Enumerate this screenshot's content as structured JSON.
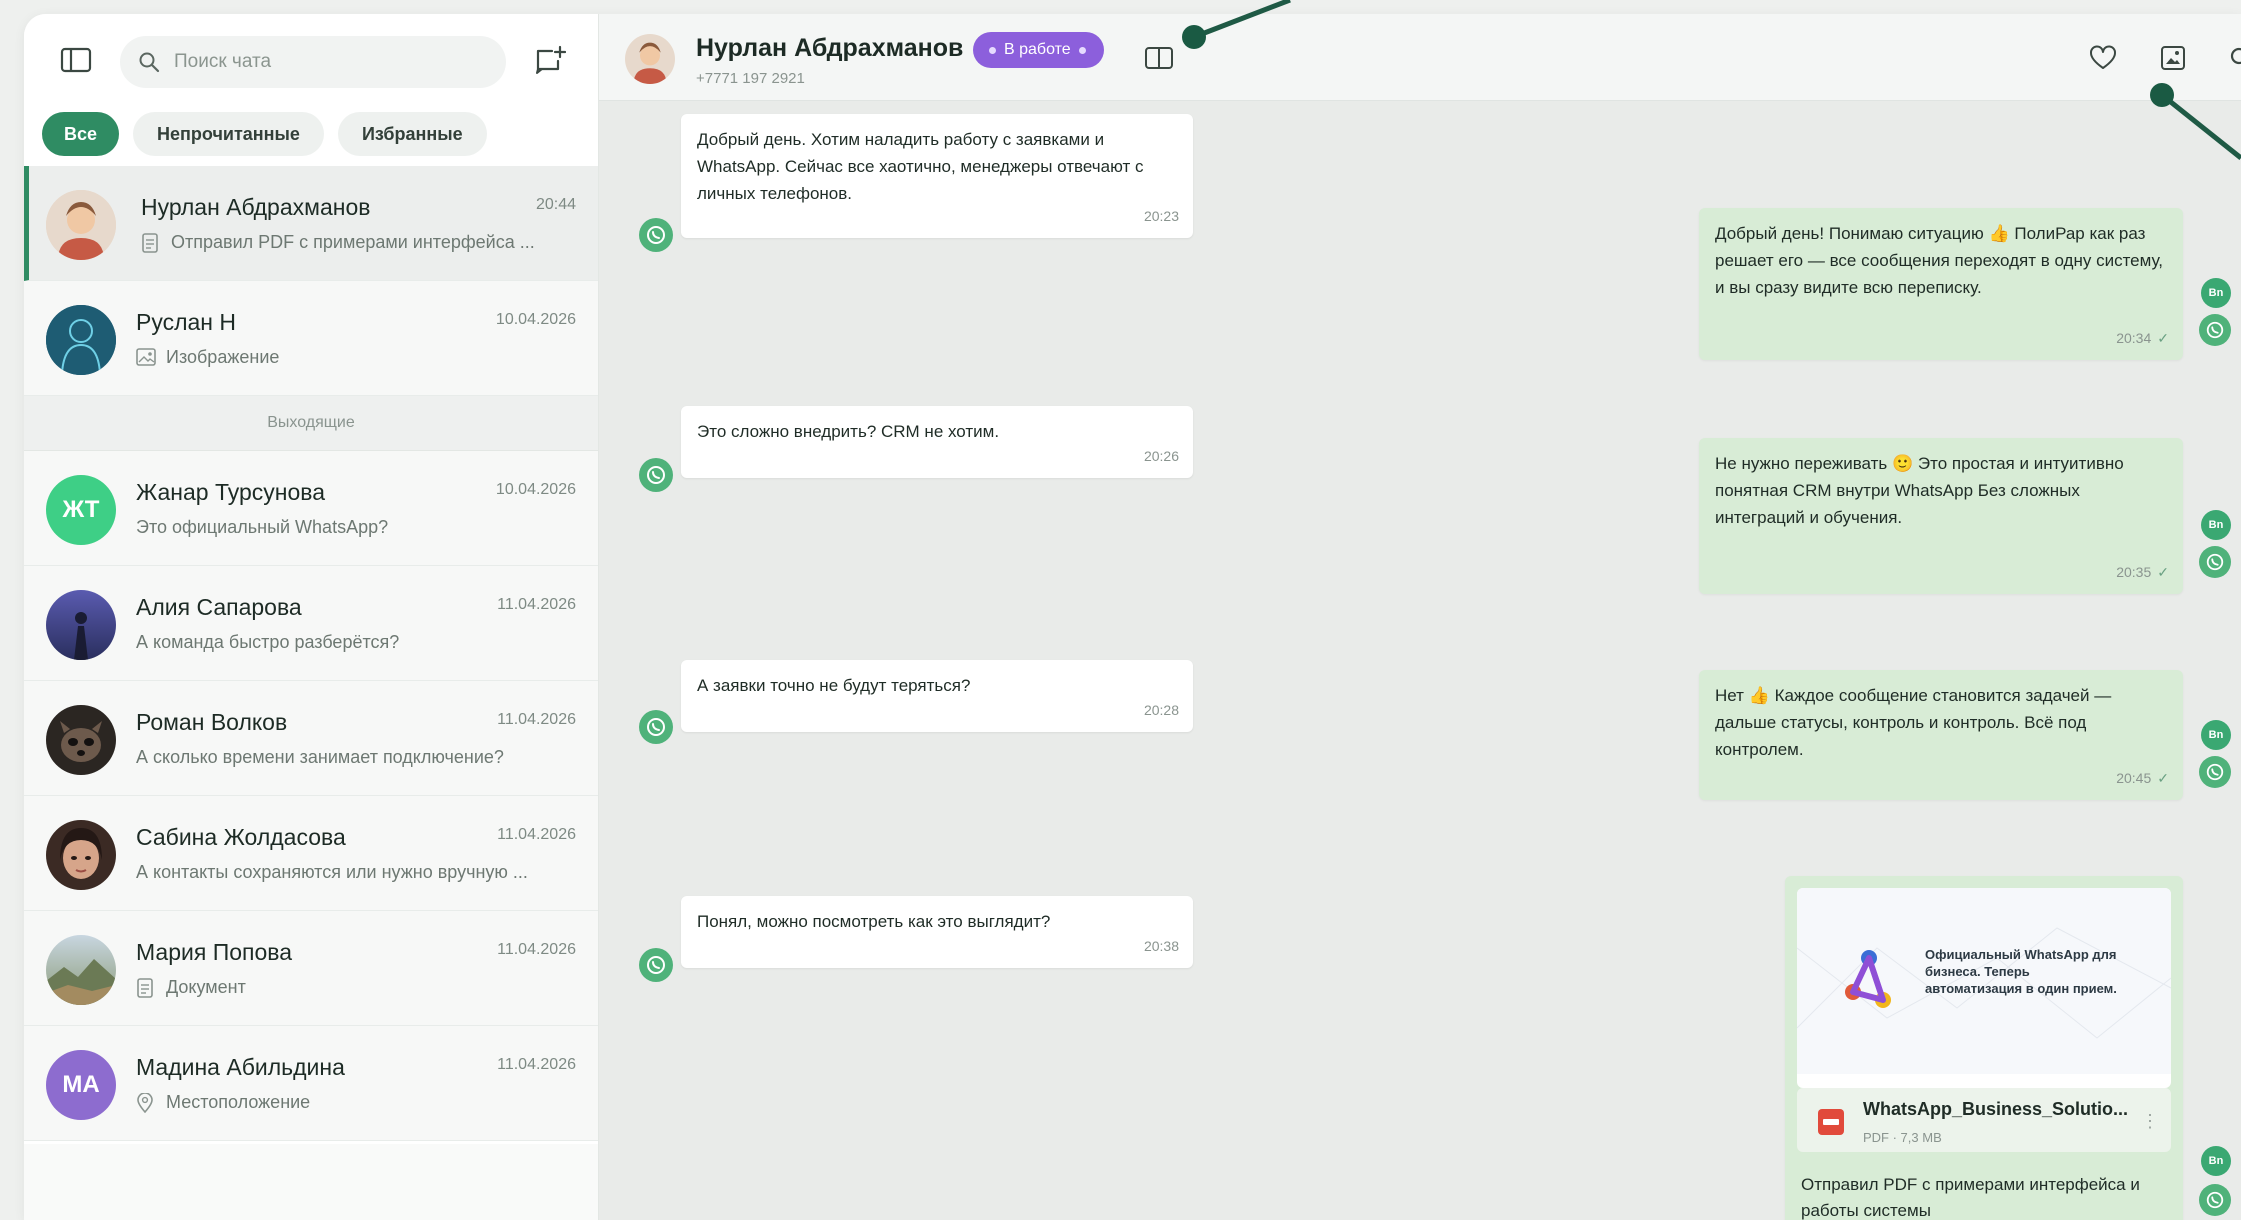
{
  "sidebar": {
    "search_placeholder": "Поиск чата",
    "filters": [
      "Все",
      "Непрочитанные",
      "Избранные"
    ],
    "section_label": "Выходящие",
    "chats": [
      {
        "name": "Нурлан Абдрахманов",
        "time": "20:44",
        "preview": "Отправил PDF с примерами интерфейса ...",
        "preview_icon": "document-icon"
      },
      {
        "name": "Руслан Н",
        "time": "10.04.2026",
        "preview": "Изображение",
        "preview_icon": "image-icon"
      },
      {
        "name": "Жанар Турсунова",
        "time": "10.04.2026",
        "preview": "Это официальный WhatsApp?",
        "initials": "ЖТ"
      },
      {
        "name": "Алия Сапарова",
        "time": "11.04.2026",
        "preview": "А команда быстро разберётся?"
      },
      {
        "name": "Роман Волков",
        "time": "11.04.2026",
        "preview": "А сколько времени занимает подключение?"
      },
      {
        "name": "Сабина Жолдасова",
        "time": "11.04.2026",
        "preview": "А контакты сохраняются или нужно вручную ..."
      },
      {
        "name": "Мария Попова",
        "time": "11.04.2026",
        "preview": "Документ",
        "preview_icon": "document-icon"
      },
      {
        "name": "Мадина Абильдина",
        "time": "11.04.2026",
        "preview": "Местоположение",
        "preview_icon": "location-icon",
        "initials": "МА"
      }
    ]
  },
  "header": {
    "name": "Нурлан Абдрахманов",
    "phone": "+7771 197 2921",
    "status": "В работе"
  },
  "messages": {
    "in": [
      {
        "text": "Добрый день. Хотим наладить работу с заявками и WhatsApp. Сейчас все хаотично, менеджеры отвечают с личных телефонов.",
        "time": "20:23"
      },
      {
        "text": "Это сложно внедрить? CRM не хотим.",
        "time": "20:26"
      },
      {
        "text": "А заявки точно не будут теряться?",
        "time": "20:28"
      },
      {
        "text": "Понял, можно посмотреть как это выглядит?",
        "time": "20:38"
      }
    ],
    "out": [
      {
        "text": "Добрый день! Понимаю ситуацию 👍 ПолиРар как раз решает его — все сообщения переходят в одну систему, и вы сразу видите всю переписку.",
        "time": "20:34"
      },
      {
        "text": "Не нужно переживать 🙂 Это простая и интуитивно понятная CRM внутри WhatsApp Без сложных интеграций и обучения.",
        "time": "20:35"
      },
      {
        "text": "Нет 👍 Каждое сообщение становится задачей — дальше статусы, контроль и контроль. Всё под контролем.",
        "time": "20:45"
      }
    ],
    "document": {
      "preview_title": "Официальный WhatsApp для бизнеса. Теперь автоматизация в один прием.",
      "file_name": "WhatsApp_Business_Solutio...",
      "file_meta": "PDF · 7,3 MB",
      "caption": "Отправил PDF с примерами интерфейса и работы системы"
    },
    "out_badge": "Bn"
  },
  "colors": {
    "accent": "#2f8c63",
    "status_pill": "#8c5fdc",
    "outgoing_bubble": "#d8ecd6",
    "incoming_bubble": "#ffffff"
  }
}
